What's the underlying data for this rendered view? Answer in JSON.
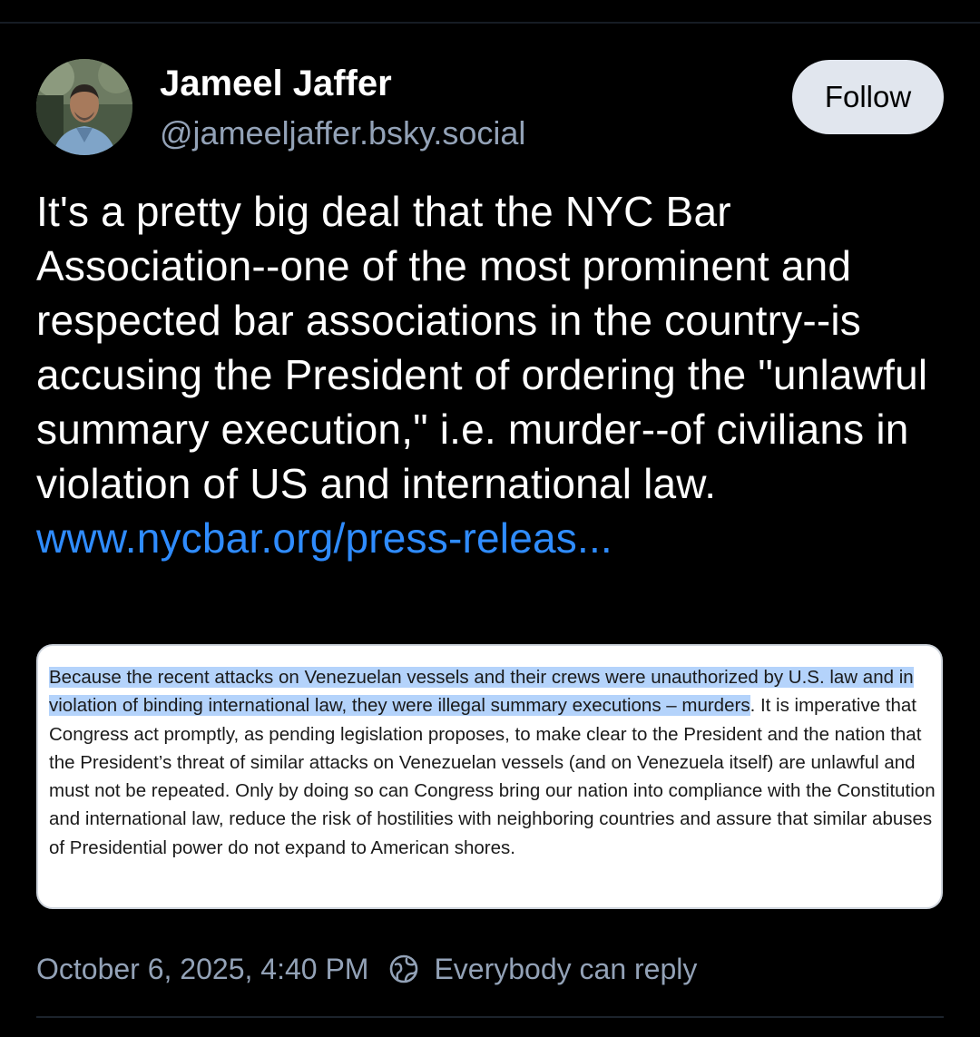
{
  "author": {
    "display_name": "Jameel Jaffer",
    "handle": "@jameeljaffer.bsky.social"
  },
  "follow_button": {
    "label": "Follow"
  },
  "post": {
    "text": "It's a pretty big deal that the NYC Bar Association--one of the most prominent and respected bar associations in the country--is accusing the President of ordering the \"unlawful summary execution,\" i.e. murder--of civilians in violation of US and international law. ",
    "link_text": "www.nycbar.org/press-releas..."
  },
  "embed": {
    "highlighted_text": "Because the recent attacks on Venezuelan vessels and their crews were unauthorized by U.S. law and in violation of binding international law, they were illegal summary executions – murders",
    "rest_text": ". It is imperative that Congress act promptly, as pending legislation proposes, to make clear to the President and the nation that the President’s threat of similar attacks on Venezuelan vessels (and on Venezuela itself) are unlawful and must not be repeated. Only by doing so can Congress bring our nation into compliance with the Constitution and international law, reduce the risk of hostilities with neighboring countries and assure that similar abuses of Presidential power do not expand to American shores."
  },
  "meta": {
    "timestamp": "October 6, 2025, 4:40 PM",
    "reply_icon": "globe-reply-icon",
    "reply_setting": "Everybody can reply"
  },
  "colors": {
    "background": "#000000",
    "link": "#2f8cff",
    "muted_text": "#93a2b7",
    "highlight": "#b4d3fb",
    "follow_button_bg": "#e1e6ee"
  }
}
